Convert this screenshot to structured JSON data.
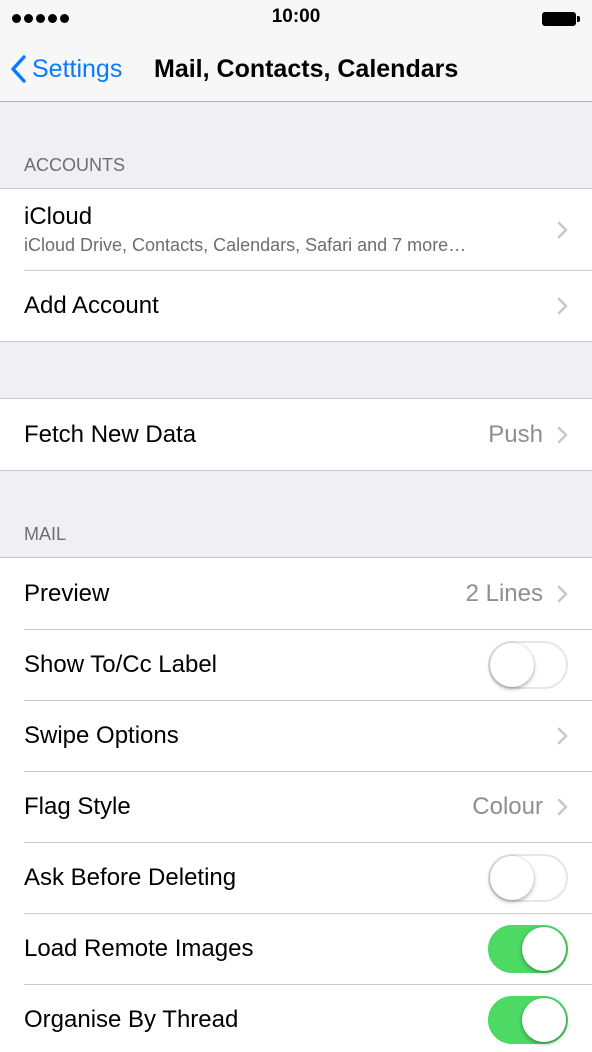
{
  "status_bar": {
    "time": "10:00"
  },
  "nav": {
    "back_label": "Settings",
    "title": "Mail, Contacts, Calendars"
  },
  "accounts": {
    "header": "ACCOUNTS",
    "icloud_label": "iCloud",
    "icloud_sub": "iCloud Drive, Contacts, Calendars, Safari and 7 more…",
    "add_account_label": "Add Account"
  },
  "fetch": {
    "label": "Fetch New Data",
    "value": "Push"
  },
  "mail": {
    "header": "MAIL",
    "preview_label": "Preview",
    "preview_value": "2 Lines",
    "show_tocc_label": "Show To/Cc Label",
    "show_tocc_on": false,
    "swipe_label": "Swipe Options",
    "flag_label": "Flag Style",
    "flag_value": "Colour",
    "ask_delete_label": "Ask Before Deleting",
    "ask_delete_on": false,
    "load_images_label": "Load Remote Images",
    "load_images_on": true,
    "organise_label": "Organise By Thread",
    "organise_on": true
  },
  "colors": {
    "accent": "#0a7aff",
    "toggle_on": "#4cd964"
  }
}
